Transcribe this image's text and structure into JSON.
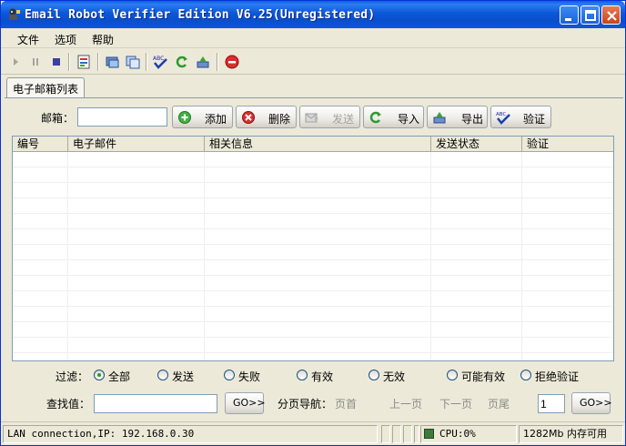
{
  "window": {
    "title": "Email Robot Verifier Edition V6.25(Unregistered)"
  },
  "menu": {
    "items": [
      "文件",
      "选项",
      "帮助"
    ]
  },
  "toolbar": {
    "icons": [
      "play-icon",
      "pause-icon",
      "stop-icon",
      "import-list-icon",
      "send-icon",
      "copy-icon",
      "verify-icon",
      "refresh-icon",
      "export-icon",
      "delete-icon"
    ]
  },
  "tabs": [
    {
      "label": "电子邮箱列表"
    }
  ],
  "email_row": {
    "label": "邮箱：",
    "input_value": "",
    "buttons": {
      "add": "添加",
      "delete": "删除",
      "send": "发送",
      "import": "导入",
      "export": "导出",
      "verify": "验证"
    }
  },
  "table": {
    "columns": [
      "编号",
      "电子邮件",
      "相关信息",
      "发送状态",
      "验证"
    ],
    "rows": []
  },
  "filter": {
    "label": "过滤：",
    "options": [
      "全部",
      "发送",
      "失败",
      "有效",
      "无效",
      "可能有效",
      "拒绝验证"
    ],
    "selected": "全部"
  },
  "search": {
    "label": "查找值：",
    "input_value": "",
    "go_label": "GO>>"
  },
  "pager": {
    "label": "分页导航：",
    "first": "页首",
    "prev": "上一页",
    "next": "下一页",
    "last": "页尾",
    "page_value": "1",
    "go_label": "GO>>"
  },
  "status": {
    "connection": "LAN connection,IP: 192.168.0.30",
    "cpu": "CPU:0%",
    "memory": "1282Mb 内存可用"
  },
  "colors": {
    "titlebar": "#0A4FCB",
    "cpu_indicator": "#3E7A3E",
    "disabled_text": "#A4A29C"
  }
}
